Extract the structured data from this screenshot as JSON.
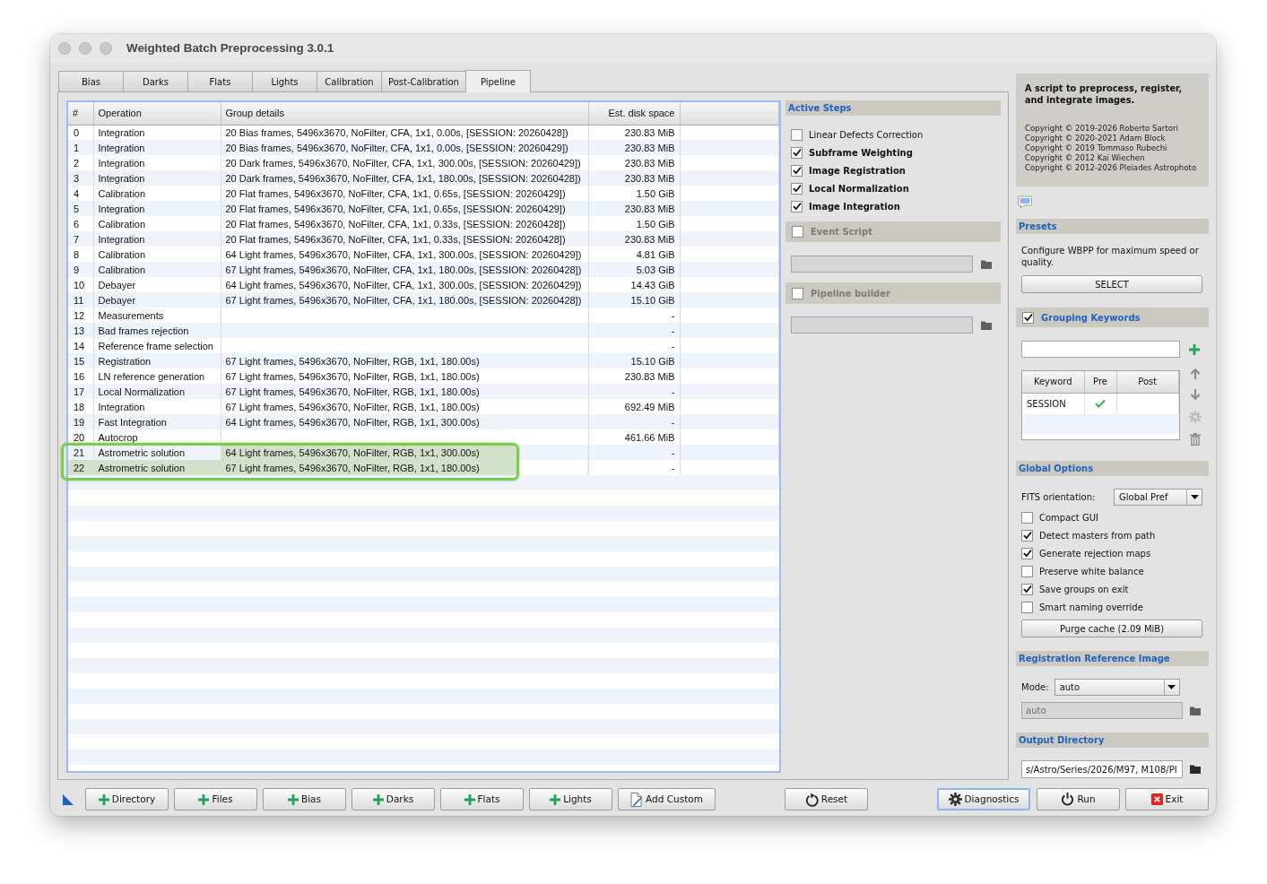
{
  "window": {
    "title": "Weighted Batch Preprocessing 3.0.1"
  },
  "tabs": [
    {
      "label": "Bias",
      "selected": false
    },
    {
      "label": "Darks",
      "selected": false
    },
    {
      "label": "Flats",
      "selected": false
    },
    {
      "label": "Lights",
      "selected": false
    },
    {
      "label": "Calibration",
      "selected": false
    },
    {
      "label": "Post-Calibration",
      "selected": false
    },
    {
      "label": "Pipeline",
      "selected": true
    }
  ],
  "pipeline_table": {
    "columns": [
      "#",
      "Operation",
      "Group details",
      "Est. disk space"
    ],
    "rows": [
      {
        "index": "0",
        "operation": "Integration",
        "group_details": "20 Bias frames, 5496x3670, NoFilter, CFA, 1x1, 0.00s, [SESSION: 20260428])",
        "disk_space": "230.83 MiB",
        "highlighted": false
      },
      {
        "index": "1",
        "operation": "Integration",
        "group_details": "20 Bias frames, 5496x3670, NoFilter, CFA, 1x1, 0.00s, [SESSION: 20260429])",
        "disk_space": "230.83 MiB",
        "highlighted": false
      },
      {
        "index": "2",
        "operation": "Integration",
        "group_details": "20 Dark frames, 5496x3670, NoFilter, CFA, 1x1, 300.00s, [SESSION: 20260429])",
        "disk_space": "230.83 MiB",
        "highlighted": false
      },
      {
        "index": "3",
        "operation": "Integration",
        "group_details": "20 Dark frames, 5496x3670, NoFilter, CFA, 1x1, 180.00s, [SESSION: 20260428])",
        "disk_space": "230.83 MiB",
        "highlighted": false
      },
      {
        "index": "4",
        "operation": "Calibration",
        "group_details": "20 Flat frames, 5496x3670, NoFilter, CFA, 1x1, 0.65s, [SESSION: 20260429])",
        "disk_space": "1.50 GiB",
        "highlighted": false
      },
      {
        "index": "5",
        "operation": "Integration",
        "group_details": "20 Flat frames, 5496x3670, NoFilter, CFA, 1x1, 0.65s, [SESSION: 20260429])",
        "disk_space": "230.83 MiB",
        "highlighted": false
      },
      {
        "index": "6",
        "operation": "Calibration",
        "group_details": "20 Flat frames, 5496x3670, NoFilter, CFA, 1x1, 0.33s, [SESSION: 20260428])",
        "disk_space": "1.50 GiB",
        "highlighted": false
      },
      {
        "index": "7",
        "operation": "Integration",
        "group_details": "20 Flat frames, 5496x3670, NoFilter, CFA, 1x1, 0.33s, [SESSION: 20260428])",
        "disk_space": "230.83 MiB",
        "highlighted": false
      },
      {
        "index": "8",
        "operation": "Calibration",
        "group_details": "64 Light frames, 5496x3670, NoFilter, CFA, 1x1, 300.00s, [SESSION: 20260429])",
        "disk_space": "4.81 GiB",
        "highlighted": false
      },
      {
        "index": "9",
        "operation": "Calibration",
        "group_details": "67 Light frames, 5496x3670, NoFilter, CFA, 1x1, 180.00s, [SESSION: 20260428])",
        "disk_space": "5.03 GiB",
        "highlighted": false
      },
      {
        "index": "10",
        "operation": "Debayer",
        "group_details": "64 Light frames, 5496x3670, NoFilter, CFA, 1x1, 300.00s, [SESSION: 20260429])",
        "disk_space": "14.43 GiB",
        "highlighted": false
      },
      {
        "index": "11",
        "operation": "Debayer",
        "group_details": "67 Light frames, 5496x3670, NoFilter, CFA, 1x1, 180.00s, [SESSION: 20260428])",
        "disk_space": "15.10 GiB",
        "highlighted": false
      },
      {
        "index": "12",
        "operation": "Measurements",
        "disk_space": "-",
        "highlighted": false
      },
      {
        "index": "13",
        "operation": "Bad frames rejection",
        "disk_space": "-",
        "highlighted": false
      },
      {
        "index": "14",
        "operation": "Reference frame selection",
        "disk_space": "-",
        "highlighted": false
      },
      {
        "index": "15",
        "operation": "Registration",
        "group_details": "67 Light frames, 5496x3670, NoFilter, RGB, 1x1, 180.00s)",
        "disk_space": "15.10 GiB",
        "highlighted": false
      },
      {
        "index": "16",
        "operation": "LN reference generation",
        "group_details": "67 Light frames, 5496x3670, NoFilter, RGB, 1x1, 180.00s)",
        "disk_space": "230.83 MiB",
        "highlighted": false
      },
      {
        "index": "17",
        "operation": "Local Normalization",
        "group_details": "67 Light frames, 5496x3670, NoFilter, RGB, 1x1, 180.00s)",
        "disk_space": "-",
        "highlighted": false
      },
      {
        "index": "18",
        "operation": "Integration",
        "group_details": "67 Light frames, 5496x3670, NoFilter, RGB, 1x1, 180.00s)",
        "disk_space": "692.49 MiB",
        "highlighted": false
      },
      {
        "index": "19",
        "operation": "Fast Integration",
        "group_details": "64 Light frames, 5496x3670, NoFilter, RGB, 1x1, 300.00s)",
        "disk_space": "-",
        "highlighted": false
      },
      {
        "index": "20",
        "operation": "Autocrop",
        "disk_space": "461.66 MiB",
        "highlighted": false
      },
      {
        "index": "21",
        "operation": "Astrometric solution",
        "group_details": "64 Light frames, 5496x3670, NoFilter, RGB, 1x1, 300.00s)",
        "disk_space": "-",
        "highlighted": true
      },
      {
        "index": "22",
        "operation": "Astrometric solution",
        "group_details": "67 Light frames, 5496x3670, NoFilter, RGB, 1x1, 180.00s)",
        "disk_space": "-",
        "highlighted": true
      }
    ]
  },
  "active_steps": {
    "title": "Active Steps",
    "steps": [
      {
        "label": "Linear Defects Correction",
        "checked": false
      },
      {
        "label": "Subframe Weighting",
        "checked": true
      },
      {
        "label": "Image Registration",
        "checked": true
      },
      {
        "label": "Local Normalization",
        "checked": true
      },
      {
        "label": "Image Integration",
        "checked": true
      }
    ]
  },
  "event_script": {
    "label": "Event Script",
    "checked": false
  },
  "pipeline_builder": {
    "label": "Pipeline builder",
    "checked": false
  },
  "about": {
    "summary": "A script to preprocess, register, and integrate images.",
    "copyrights": [
      "Copyright © 2019-2026 Roberto Sartori",
      "Copyright © 2020-2021 Adam Block",
      "Copyright © 2019 Tommaso Rubechi",
      "Copyright © 2012 Kai Wiechen",
      "Copyright © 2012-2026 Pleiades Astrophoto"
    ]
  },
  "presets": {
    "title": "Presets",
    "description": "Configure WBPP for maximum speed or quality.",
    "button": "SELECT"
  },
  "grouping_keywords": {
    "title": "Grouping Keywords",
    "checked": true,
    "columns": [
      "Keyword",
      "Pre",
      "Post"
    ],
    "rows": [
      {
        "keyword": "SESSION",
        "pre": true,
        "post": false
      }
    ]
  },
  "global_options": {
    "title": "Global Options",
    "fits_orientation": {
      "label": "FITS orientation:",
      "value": "Global Pref"
    },
    "options": [
      {
        "label": "Compact GUI",
        "checked": false
      },
      {
        "label": "Detect masters from path",
        "checked": true
      },
      {
        "label": "Generate rejection maps",
        "checked": true
      },
      {
        "label": "Preserve white balance",
        "checked": false
      },
      {
        "label": "Save groups on exit",
        "checked": true
      },
      {
        "label": "Smart naming override",
        "checked": false
      }
    ],
    "purge_button": "Purge cache (2.09 MiB)"
  },
  "registration_reference": {
    "title": "Registration Reference Image",
    "mode": {
      "label": "Mode:",
      "value": "auto"
    },
    "image_field": {
      "value": "auto",
      "disabled": true
    }
  },
  "output_directory": {
    "title": "Output Directory",
    "path": "s/Astro/Series/2026/M97, M108/PI"
  },
  "bottom_buttons": [
    {
      "label": "Directory",
      "kind": "add",
      "focused": false
    },
    {
      "label": "Files",
      "kind": "add",
      "focused": false
    },
    {
      "label": "Bias",
      "kind": "add",
      "focused": false
    },
    {
      "label": "Darks",
      "kind": "add",
      "focused": false
    },
    {
      "label": "Flats",
      "kind": "add",
      "focused": false
    },
    {
      "label": "Lights",
      "kind": "add",
      "focused": false
    },
    {
      "label": "Add Custom",
      "kind": "custom",
      "focused": false
    },
    {
      "label": "Reset",
      "kind": "reset",
      "focused": false
    },
    {
      "label": "Diagnostics",
      "kind": "diagnostics",
      "focused": true
    },
    {
      "label": "Run",
      "kind": "run",
      "focused": false
    },
    {
      "label": "Exit",
      "kind": "exit",
      "focused": false
    }
  ]
}
